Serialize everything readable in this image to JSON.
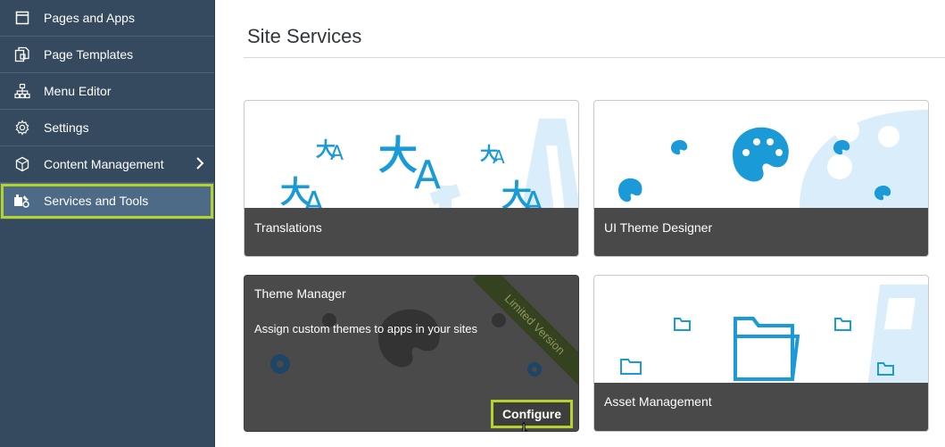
{
  "sidebar": {
    "items": [
      {
        "label": "Pages and Apps",
        "icon": "pages-icon"
      },
      {
        "label": "Page Templates",
        "icon": "templates-icon"
      },
      {
        "label": "Menu Editor",
        "icon": "sitemap-icon"
      },
      {
        "label": "Settings",
        "icon": "gear-icon"
      },
      {
        "label": "Content Management",
        "icon": "cube-icon"
      },
      {
        "label": "Services and Tools",
        "icon": "tools-icon"
      }
    ]
  },
  "main": {
    "title": "Site Services",
    "tiles": [
      {
        "label": "Translations"
      },
      {
        "label": "UI Theme Designer"
      },
      {
        "label": "Theme Manager",
        "description": "Assign custom themes to apps in your sites",
        "ribbon": "Limited Version",
        "button": "Configure"
      },
      {
        "label": "Asset Management"
      }
    ]
  },
  "colors": {
    "sidebar_bg": "#354a5f",
    "active_bg": "#4d6a86",
    "highlight": "#b4d42b",
    "accent_blue": "#1a9ad6",
    "tile_band": "#494949"
  }
}
